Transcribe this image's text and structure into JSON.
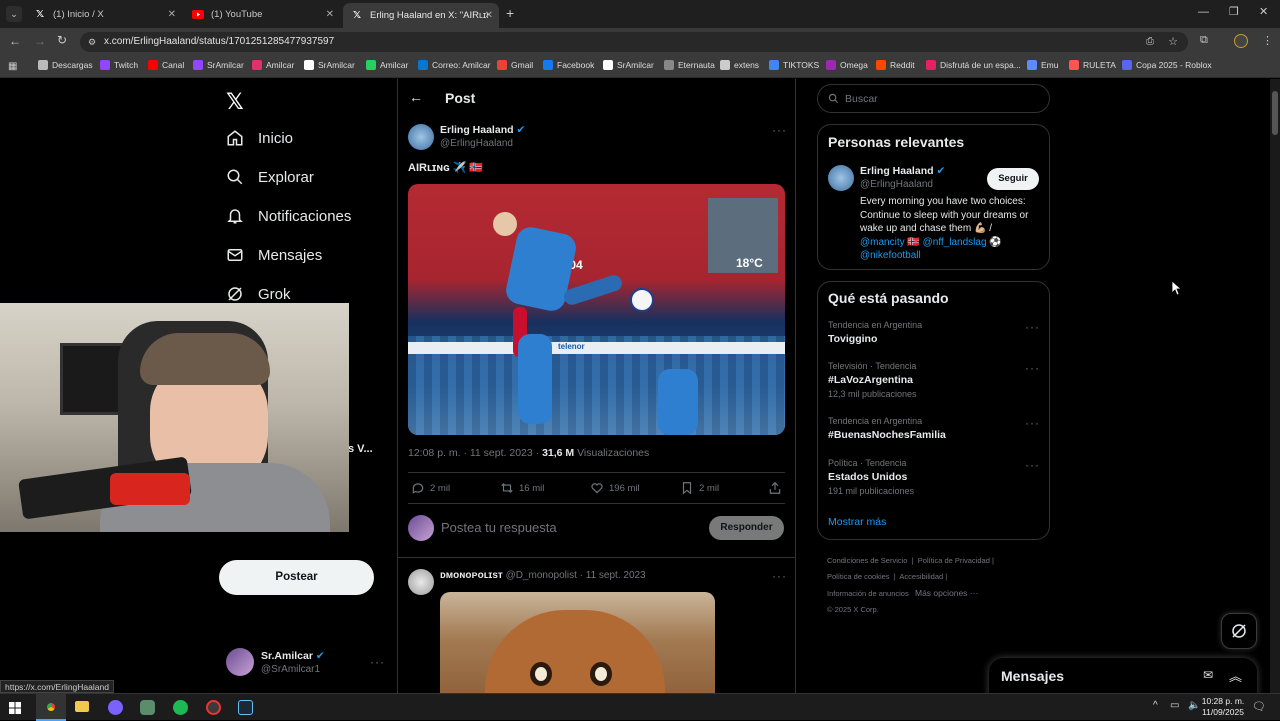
{
  "browser": {
    "tabs": [
      {
        "title": "(1) Inicio / X",
        "icon": "x-logo-icon"
      },
      {
        "title": "(1) YouTube",
        "icon": "youtube-icon"
      },
      {
        "title": "Erling Haaland en X: \"AIRʟɪɴɢ ✈",
        "icon": "x-logo-icon"
      }
    ],
    "url": "x.com/ErlingHaaland/status/1701251285477937597",
    "status_url": "https://x.com/ErlingHaaland",
    "bookmarks": [
      {
        "label": "Descargas",
        "color": "#bbbbbb"
      },
      {
        "label": "Twitch",
        "color": "#9146ff"
      },
      {
        "label": "Canal",
        "color": "#ff0000"
      },
      {
        "label": "SrAmilcar",
        "color": "#9146ff"
      },
      {
        "label": "Amilcar",
        "color": "#e1306c"
      },
      {
        "label": "SrAmilcar",
        "color": "#ffffff"
      },
      {
        "label": "Amilcar",
        "color": "#23d160"
      },
      {
        "label": "Correo: Amilcar",
        "color": "#0078d4"
      },
      {
        "label": "Gmail",
        "color": "#ea4335"
      },
      {
        "label": "Facebook",
        "color": "#1877f2"
      },
      {
        "label": "SrAmilcar",
        "color": "#ffffff"
      },
      {
        "label": "Eternauta",
        "color": "#888888"
      },
      {
        "label": "extens",
        "color": "#cccccc"
      },
      {
        "label": "TIKTOKS",
        "color": "#4285f4"
      },
      {
        "label": "Omega",
        "color": "#9c27b0"
      },
      {
        "label": "Reddit",
        "color": "#ff4500"
      },
      {
        "label": "Disfrutá de un espa...",
        "color": "#e91e63"
      },
      {
        "label": "Emu",
        "color": "#5b8cff"
      },
      {
        "label": "RULETA",
        "color": "#ff5252"
      },
      {
        "label": "Copa 2025 - Roblox",
        "color": "#5865f2"
      }
    ]
  },
  "nav": {
    "items": [
      {
        "label": "Inicio",
        "icon": "home-icon"
      },
      {
        "label": "Explorar",
        "icon": "search-icon"
      },
      {
        "label": "Notificaciones",
        "icon": "bell-icon"
      },
      {
        "label": "Mensajes",
        "icon": "mail-icon"
      },
      {
        "label": "Grok",
        "icon": "grok-icon"
      }
    ],
    "partial_text": "s V...",
    "post_button": "Postear",
    "account": {
      "name": "Sr.Amilcar",
      "handle": "@SrAmilcar1"
    }
  },
  "post": {
    "header_title": "Post",
    "author": "Erling Haaland",
    "handle": "@ErlingHaaland",
    "text": "AIRʟɪɴɢ ✈️ 🇳🇴",
    "image_texts": {
      "scoreboard": "13.04.04",
      "temperature": "18°C",
      "ad": "telenor"
    },
    "time": "12:08 p. m. · 11 sept. 2023 · ",
    "views_count": "31,6 M",
    "views_label": " Visualizaciones",
    "replies": "2 mil",
    "reposts": "16 mil",
    "likes": "196 mil",
    "bookmarks": "2 mil",
    "reply_placeholder": "Postea tu respuesta",
    "reply_button": "Responder"
  },
  "reply": {
    "author": "ᴅᴍᴏɴᴏᴘᴏʟɪsᴛ",
    "meta": "@D_monopolist · 11 sept. 2023"
  },
  "sidebar": {
    "search_placeholder": "Buscar",
    "relevant_title": "Personas relevantes",
    "person": {
      "name": "Erling Haaland",
      "handle": "@ErlingHaaland",
      "follow": "Seguir",
      "bio": "Every morning you have two choices: Continue to sleep with your dreams or wake up and chase them 💪🏼 /",
      "links": "@mancity 🇳🇴 @nff_landslag ⚽",
      "link2": "@nikefootball"
    },
    "trends_title": "Qué está pasando",
    "trends": [
      {
        "category": "Tendencia en Argentina",
        "name": "Toviggino",
        "count": ""
      },
      {
        "category": "Televisión · Tendencia",
        "name": "#LaVozArgentina",
        "count": "12,3 mil publicaciones"
      },
      {
        "category": "Tendencia en Argentina",
        "name": "#BuenasNochesFamilia",
        "count": ""
      },
      {
        "category": "Política · Tendencia",
        "name": "Estados Unidos",
        "count": "191 mil publicaciones"
      }
    ],
    "show_more": "Mostrar más",
    "footer": {
      "l1": "Condiciones de Servicio",
      "l2": "Política de Privacidad",
      "l3": "Política de cookies",
      "l4": "Accesibilidad",
      "l5": "Información de anuncios",
      "l6": "Más opciones ···",
      "l7": "© 2025 X Corp."
    },
    "messages_title": "Mensajes"
  },
  "taskbar": {
    "time": "10:28 p. m.",
    "date": "11/09/2025"
  }
}
